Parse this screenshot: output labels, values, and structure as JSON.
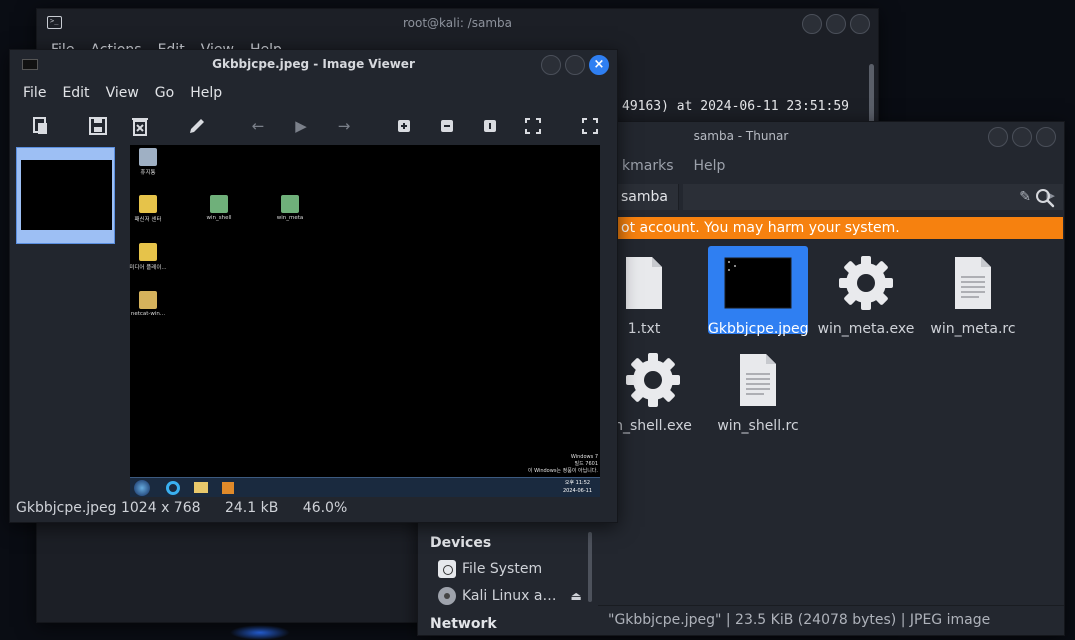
{
  "terminal": {
    "title": "root@kali: /samba",
    "menu": [
      "File",
      "Actions",
      "Edit",
      "View",
      "Help"
    ],
    "output_line": "49163) at 2024-06-11 23:51:59"
  },
  "thunar": {
    "title": "samba - Thunar",
    "menu": [
      "kmarks",
      "Help"
    ],
    "location_crumb": "samba",
    "warning": "ot account. You may harm your system.",
    "files": [
      {
        "name": "1.txt",
        "icon": "text-file-icon"
      },
      {
        "name": "Gkbbjcpe.jpeg",
        "icon": "image-file-icon",
        "selected": true
      },
      {
        "name": "win_meta.exe",
        "icon": "executable-gear-icon"
      },
      {
        "name": "win_meta.rc",
        "icon": "document-file-icon"
      },
      {
        "name": "n_shell.exe",
        "icon": "executable-gear-icon"
      },
      {
        "name": "win_shell.rc",
        "icon": "document-file-icon"
      }
    ],
    "sidebar": {
      "devices_header": "Devices",
      "file_system": "File System",
      "kali_linux": "Kali Linux a…",
      "network_header": "Network"
    },
    "status": "\"Gkbbjcpe.jpeg\"  |  23.5 KiB (24078 bytes)  |  JPEG image",
    "colors": {
      "warning_bg": "#f6810f",
      "selection": "#2f7ff2"
    }
  },
  "viewer": {
    "title": "Gkbbjcpe.jpeg - Image Viewer",
    "menu": [
      "File",
      "Edit",
      "View",
      "Go",
      "Help"
    ],
    "status": {
      "filename_dims": "Gkbbjcpe.jpeg 1024 x 768",
      "size": "24.1 kB",
      "zoom": "46.0%"
    },
    "screenshot": {
      "desktop_icons": [
        "휴지통",
        "패신저 센터",
        "win_shell",
        "win_meta",
        "미디어 플레이...",
        "netcat-win..."
      ],
      "watermark": [
        "Windows 7",
        "빌드 7601",
        "이 Windows는 정품이 아닙니다."
      ],
      "clock": [
        "오후 11:52",
        "2024-06-11"
      ]
    }
  }
}
